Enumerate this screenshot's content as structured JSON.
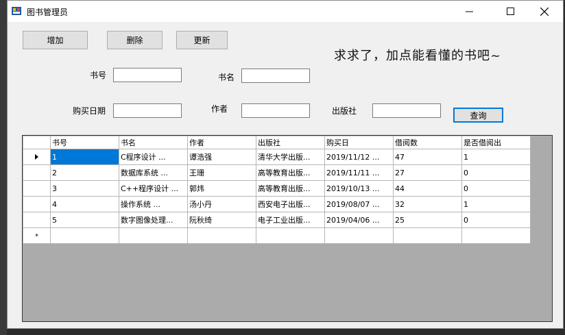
{
  "window": {
    "title": "图书管理员"
  },
  "toolbar": {
    "add_label": "增加",
    "delete_label": "删除",
    "update_label": "更新",
    "query_label": "查询"
  },
  "slogan": "求求了，加点能看懂的书吧~",
  "form": {
    "book_id_label": "书号",
    "book_name_label": "书名",
    "purchase_date_label": "购买日期",
    "author_label": "作者",
    "publisher_label": "出版社"
  },
  "grid": {
    "columns": [
      "书号",
      "书名",
      "作者",
      "出版社",
      "购买日",
      "借阅数",
      "是否借阅出"
    ],
    "rows": [
      [
        "1",
        "C程序设计    ...",
        "谭浩强",
        "清华大学出版...",
        "2019/11/12  ...",
        "47",
        "1"
      ],
      [
        "2",
        "数据库系统   ...",
        "王珊",
        "高等教育出版...",
        "2019/11/11  ...",
        "27",
        "0"
      ],
      [
        "3",
        "C++程序设计  ...",
        "郭炜",
        "高等教育出版...",
        "2019/10/13  ...",
        "44",
        "0"
      ],
      [
        "4",
        "操作系统     ...",
        "汤小丹",
        "西安电子出版...",
        "2019/08/07  ...",
        "32",
        "1"
      ],
      [
        "5",
        "数字图像处理...",
        "阮秋绮",
        "电子工业出版...",
        "2019/04/06  ...",
        "25",
        "0"
      ]
    ]
  },
  "colors": {
    "accent": "#0078d7",
    "grid_bg": "#ababab",
    "window_bg": "#f0f0f0"
  }
}
